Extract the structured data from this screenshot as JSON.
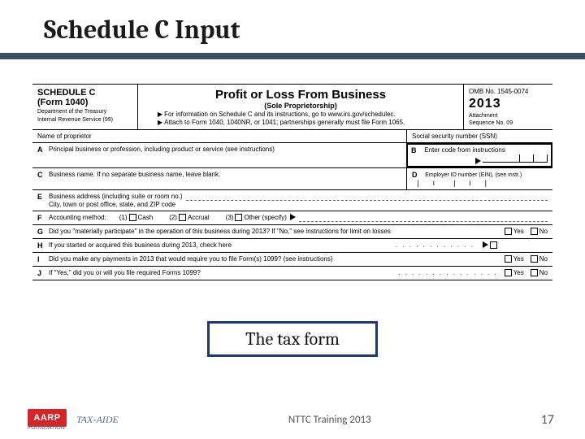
{
  "slide": {
    "title": "Schedule C Input",
    "callout": "The tax form",
    "footer_center": "NTTC Training 2013",
    "page_number": "17",
    "aarp_label": "AARP",
    "foundation": "FOUNDATION",
    "taxaide": "TAX-AIDE"
  },
  "form": {
    "header": {
      "schedule": "SCHEDULE C",
      "form_num": "(Form 1040)",
      "dept1": "Department of the Treasury",
      "dept2": "Internal Revenue Service (99)",
      "title": "Profit or Loss From Business",
      "subtitle": "(Sole Proprietorship)",
      "info1": "For information on Schedule C and its instructions, go to www.irs.gov/schedulec.",
      "info2": "Attach to Form 1040, 1040NR, or 1041; partnerships generally must file Form 1065.",
      "omb": "OMB No. 1545-0074",
      "year": "2013",
      "attach": "Attachment",
      "seq": "Sequence No. 09"
    },
    "proprietor": {
      "name_label": "Name of proprietor",
      "ssn_label": "Social security number (SSN)"
    },
    "A": {
      "letter": "A",
      "text": "Principal business or profession, including product or service (see instructions)"
    },
    "B": {
      "letter": "B",
      "text": "Enter code from instructions"
    },
    "C": {
      "letter": "C",
      "text": "Business name. If no separate business name, leave blank."
    },
    "D": {
      "letter": "D",
      "text": "Employer ID number (EIN), (see instr.)"
    },
    "E": {
      "letter": "E",
      "text1": "Business address (including suite or room no.)",
      "text2": "City, town or post office, state, and ZIP code"
    },
    "F": {
      "letter": "F",
      "text": "Accounting method:",
      "opt1": "(1)",
      "cash": "Cash",
      "opt2": "(2)",
      "accrual": "Accrual",
      "opt3": "(3)",
      "other": "Other (specify)"
    },
    "G": {
      "letter": "G",
      "text": "Did you \"materially participate\" in the operation of this business during 2013? If \"No,\" see instructions for limit on losses"
    },
    "H": {
      "letter": "H",
      "text": "If you started or acquired this business during 2013, check here"
    },
    "I": {
      "letter": "I",
      "text": "Did you make any payments in 2013 that would require you to file Form(s) 1099? (see instructions)"
    },
    "J": {
      "letter": "J",
      "text": "If \"Yes,\" did you or will you file required Forms 1099?"
    },
    "yes": "Yes",
    "no": "No"
  }
}
